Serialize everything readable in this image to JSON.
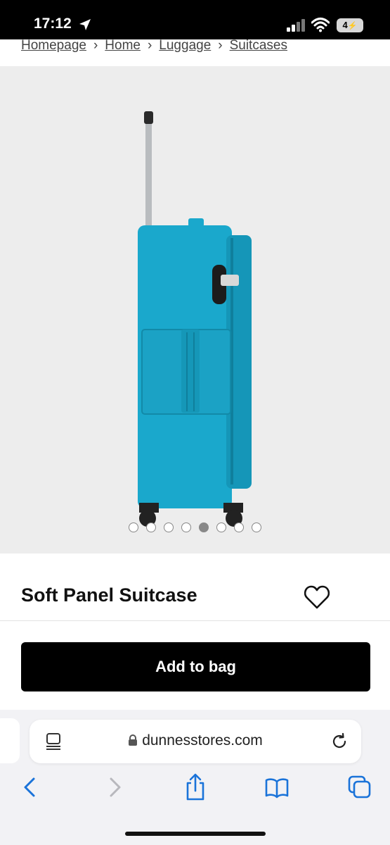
{
  "status_bar": {
    "time": "17:12",
    "battery": "4"
  },
  "breadcrumb": [
    "Homepage",
    "Home",
    "Luggage",
    "Suitcases"
  ],
  "gallery": {
    "slide_count": 8,
    "active_index": 4
  },
  "product": {
    "title": "Soft Panel Suitcase",
    "add_to_bag_label": "Add to bag"
  },
  "browser": {
    "url": "dunnesstores.com"
  },
  "icons": {
    "location": "location-arrow-icon",
    "signal": "signal-icon",
    "wifi": "wifi-icon",
    "wishlist": "heart-icon",
    "reader": "reader-mode-icon",
    "lock": "lock-icon",
    "reload": "reload-icon",
    "back": "chevron-left-icon",
    "forward": "chevron-right-icon",
    "share": "share-icon",
    "bookmarks": "book-icon",
    "tabs": "tabs-icon"
  },
  "colors": {
    "accent": "#1a73d9",
    "suitcase": "#1aa8cc",
    "button": "#000000"
  }
}
